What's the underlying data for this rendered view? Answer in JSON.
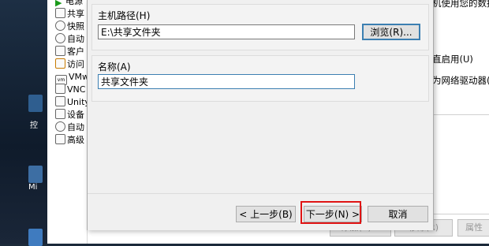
{
  "desktop": {
    "labels": [
      "控",
      "Mi"
    ]
  },
  "tree": {
    "items": [
      {
        "label": "电源"
      },
      {
        "label": "共享"
      },
      {
        "label": "快照"
      },
      {
        "label": "自动"
      },
      {
        "label": "客户"
      },
      {
        "label": "访问"
      },
      {
        "label": "VMw"
      },
      {
        "label": "VNC"
      },
      {
        "label": "Unity"
      },
      {
        "label": "设备"
      },
      {
        "label": "自动"
      },
      {
        "label": "高级"
      }
    ]
  },
  "background_window": {
    "text_top": "机使用您的数据",
    "text_enable": "直启用(U)",
    "text_map": "为网络驱动器(M)",
    "buttons": [
      "添加(A)...",
      "移除(R)",
      "属性"
    ]
  },
  "dialog": {
    "host_path_label": "主机路径(H)",
    "host_path_value": "E:\\共享文件夹",
    "browse_label": "浏览(R)...",
    "name_label": "名称(A)",
    "name_value": "共享文件夹",
    "back_label": "< 上一步(B)",
    "next_label": "下一步(N) >",
    "cancel_label": "取消"
  },
  "colors": {
    "highlight": "#e01414",
    "focus_border": "#3c7fb1"
  }
}
